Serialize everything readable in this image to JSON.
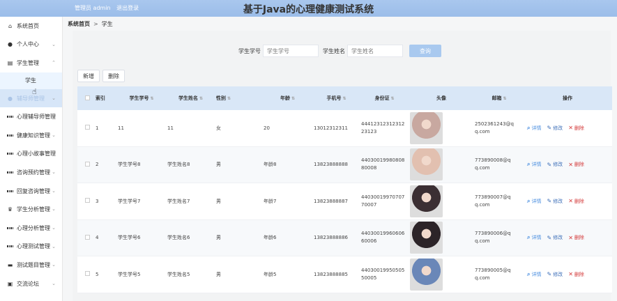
{
  "header": {
    "user_label": "管理员 admin",
    "logout_label": "退出登录",
    "title": "基于Java的心理健康测试系统"
  },
  "sidebar": {
    "items": [
      {
        "label": "系统首页",
        "icon": "home-icon"
      },
      {
        "label": "个人中心",
        "icon": "person-icon",
        "arrow": "⌄"
      },
      {
        "label": "学生管理",
        "icon": "document-icon",
        "arrow": "⌃"
      },
      {
        "label": "辅导师管理",
        "icon": "person-icon",
        "arrow": "⌄"
      },
      {
        "label": "心理辅导师管理",
        "icon": "grid-icon",
        "arrow": "⌄"
      },
      {
        "label": "健康知识管理",
        "icon": "grid-icon",
        "arrow": "⌄"
      },
      {
        "label": "心理小故事管理",
        "icon": "grid-icon",
        "arrow": "⌄"
      },
      {
        "label": "咨询预约管理",
        "icon": "grid-icon",
        "arrow": "⌄"
      },
      {
        "label": "回复咨询管理",
        "icon": "grid-icon",
        "arrow": "⌄"
      },
      {
        "label": "学生分析管理",
        "icon": "trophy-icon",
        "arrow": "⌄"
      },
      {
        "label": "心理分析管理",
        "icon": "grid-icon",
        "arrow": "⌄"
      },
      {
        "label": "心理测试管理",
        "icon": "grid-icon",
        "arrow": "⌄"
      },
      {
        "label": "测试题目管理",
        "icon": "ticket-icon",
        "arrow": "⌄"
      },
      {
        "label": "交流论坛",
        "icon": "forum-icon",
        "arrow": "⌄"
      }
    ],
    "sub_item": "学生"
  },
  "breadcrumb": {
    "home": "系统首页",
    "sep": ">",
    "current": "学生"
  },
  "search": {
    "no_label": "学生学号",
    "no_placeholder": "学生学号",
    "name_label": "学生姓名",
    "name_placeholder": "学生姓名",
    "query_label": "查询"
  },
  "actions": {
    "add_label": "新增",
    "delete_label": "删除"
  },
  "table": {
    "headers": {
      "index": "索引",
      "no": "学生学号",
      "name": "学生姓名",
      "sex": "性别",
      "age": "年龄",
      "phone": "手机号",
      "idcard": "身份证",
      "photo": "头像",
      "email": "邮箱",
      "ops": "操作"
    },
    "rows": [
      {
        "index": "1",
        "no": "11",
        "name": "11",
        "sex": "女",
        "age": "20",
        "phone": "13012312311",
        "id1": "44412312312312",
        "id2": "23123",
        "mail1": "2502361243@q",
        "mail2": "q.com",
        "photo_color": "#c8a8a0"
      },
      {
        "index": "2",
        "no": "学生学号8",
        "name": "学生姓名8",
        "sex": "男",
        "age": "年龄8",
        "phone": "13823888888",
        "id1": "44030019980808",
        "id2": "80008",
        "mail1": "773890008@q",
        "mail2": "q.com",
        "photo_color": "#e2c0b0"
      },
      {
        "index": "3",
        "no": "学生学号7",
        "name": "学生姓名7",
        "sex": "男",
        "age": "年龄7",
        "phone": "13823888887",
        "id1": "44030019970707",
        "id2": "70007",
        "mail1": "773890007@q",
        "mail2": "q.com",
        "photo_color": "#3b2f33"
      },
      {
        "index": "4",
        "no": "学生学号6",
        "name": "学生姓名6",
        "sex": "男",
        "age": "年龄6",
        "phone": "13823888886",
        "id1": "44030019960606",
        "id2": "60006",
        "mail1": "773890006@q",
        "mail2": "q.com",
        "photo_color": "#2c2428"
      },
      {
        "index": "5",
        "no": "学生学号5",
        "name": "学生姓名5",
        "sex": "男",
        "age": "年龄5",
        "phone": "13823888885",
        "id1": "44030019950505",
        "id2": "50005",
        "mail1": "773890005@q",
        "mail2": "q.com",
        "photo_color": "#6a87b8"
      }
    ],
    "ops": {
      "view": "详情",
      "edit": "修改",
      "del": "删除"
    }
  },
  "colors": {
    "header_bg": "#a9c7ee",
    "accent": "#a9c9ef",
    "danger": "#d43a3a"
  }
}
